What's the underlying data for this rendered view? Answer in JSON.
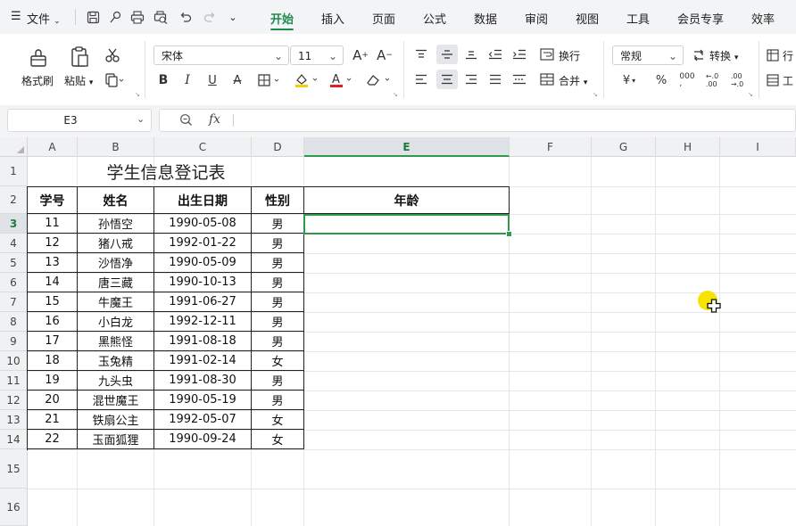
{
  "menubar": {
    "file_label": "文件",
    "tabs": [
      "开始",
      "插入",
      "页面",
      "公式",
      "数据",
      "审阅",
      "视图",
      "工具",
      "会员专享",
      "效率"
    ],
    "active_tab": "开始"
  },
  "ribbon": {
    "format_painter": "格式刷",
    "paste": "粘贴",
    "font_name": "宋体",
    "font_size": "11",
    "wrap_text": "换行",
    "merge": "合并",
    "number_format": "常规",
    "convert": "转换",
    "row_col": "行",
    "worksheet": "工",
    "accent_color": "#1f8a4c",
    "font_color_bar": "#e02020",
    "fill_color_bar": "#f5d000"
  },
  "formula_bar": {
    "name_box": "E3",
    "fx": "fx",
    "value": ""
  },
  "columns": [
    "A",
    "B",
    "C",
    "D",
    "E",
    "F",
    "G",
    "H",
    "I"
  ],
  "selected_column": "E",
  "rows": [
    "1",
    "2",
    "3",
    "4",
    "5",
    "6",
    "7",
    "8",
    "9",
    "10",
    "11",
    "12",
    "13",
    "14",
    "15",
    "16"
  ],
  "selected_row": "3",
  "sheet": {
    "title": "学生信息登记表",
    "headers": [
      "学号",
      "姓名",
      "出生日期",
      "性别",
      "年龄"
    ],
    "records": [
      [
        "11",
        "孙悟空",
        "1990-05-08",
        "男"
      ],
      [
        "12",
        "猪八戒",
        "1992-01-22",
        "男"
      ],
      [
        "13",
        "沙悟净",
        "1990-05-09",
        "男"
      ],
      [
        "14",
        "唐三藏",
        "1990-10-13",
        "男"
      ],
      [
        "15",
        "牛魔王",
        "1991-06-27",
        "男"
      ],
      [
        "16",
        "小白龙",
        "1992-12-11",
        "男"
      ],
      [
        "17",
        "黑熊怪",
        "1991-08-18",
        "男"
      ],
      [
        "18",
        "玉兔精",
        "1991-02-14",
        "女"
      ],
      [
        "19",
        "九头虫",
        "1991-08-30",
        "男"
      ],
      [
        "20",
        "混世魔王",
        "1990-05-19",
        "男"
      ],
      [
        "21",
        "铁扇公主",
        "1992-05-07",
        "女"
      ],
      [
        "22",
        "玉面狐狸",
        "1990-09-24",
        "女"
      ]
    ]
  },
  "active_cell": "E3",
  "cursor_highlight_color": "#f5e400"
}
